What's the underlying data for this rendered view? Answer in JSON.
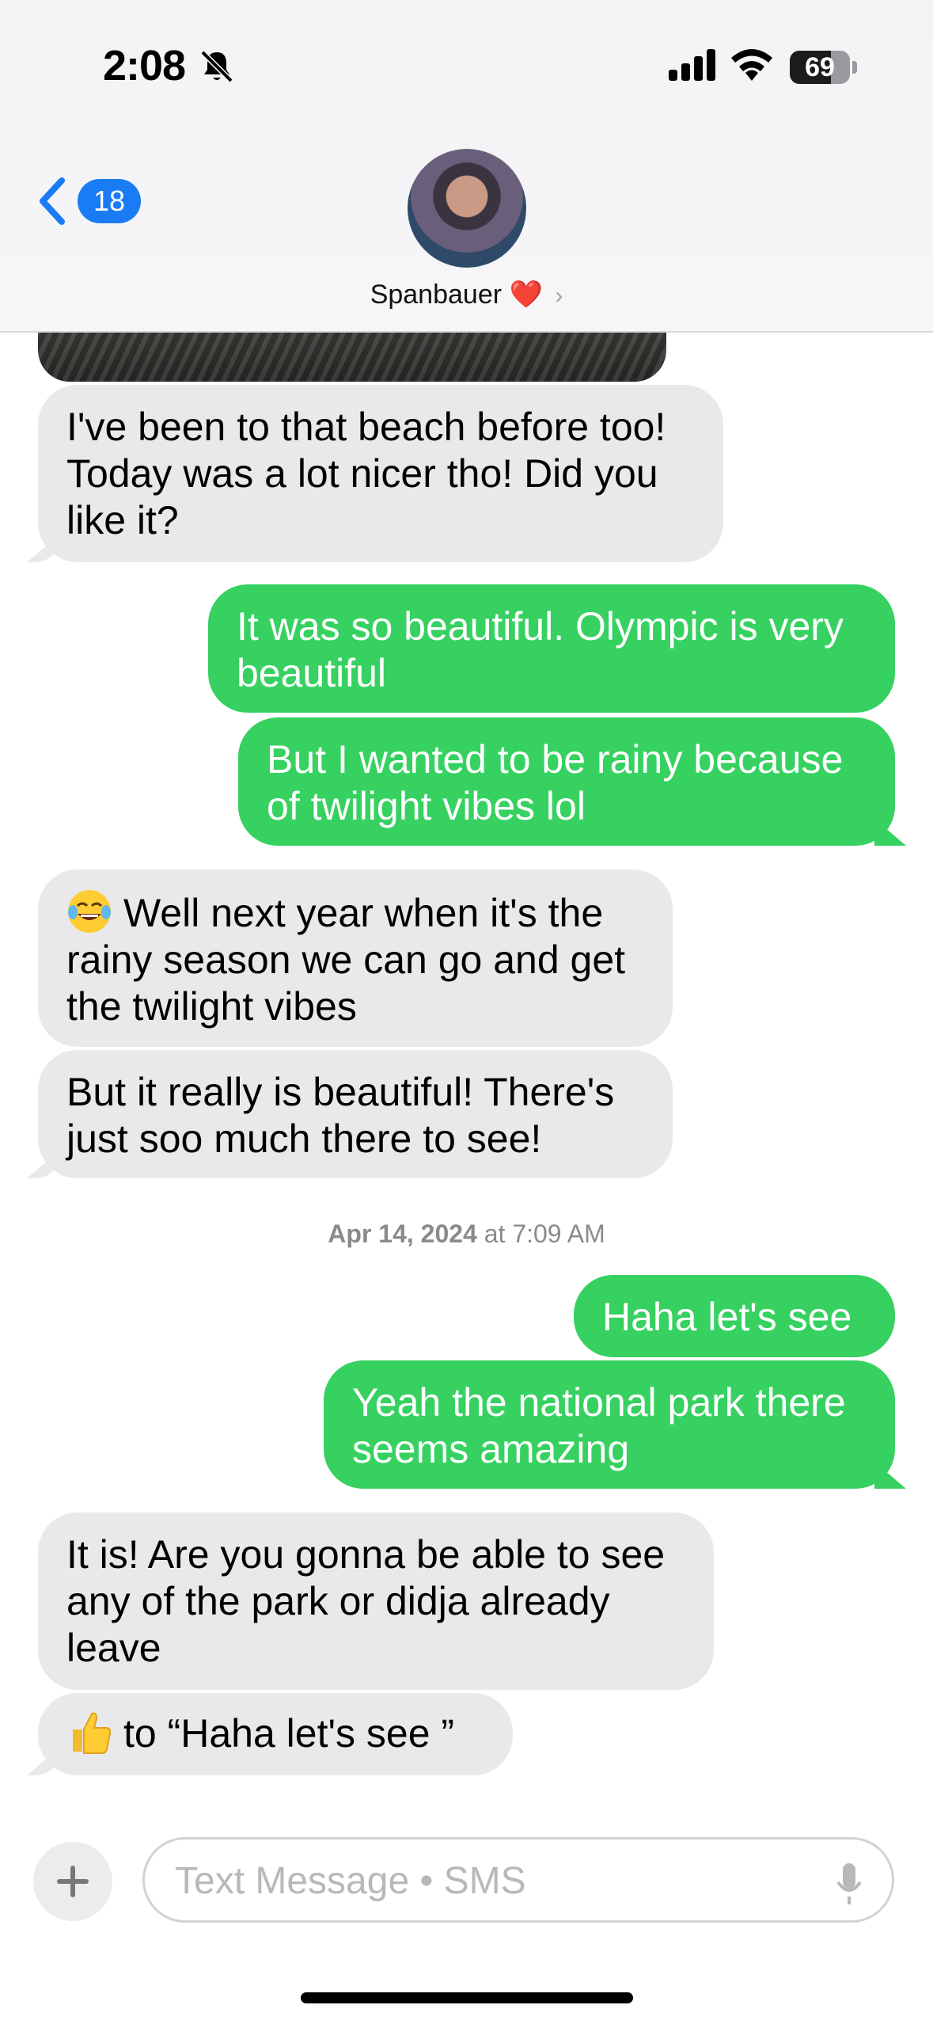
{
  "status_bar": {
    "time": "2:08",
    "battery": "69",
    "battery_level": 0.69
  },
  "header": {
    "back_count": "18",
    "contact_name": "Spanbauer",
    "contact_heart": "❤️"
  },
  "messages": [
    {
      "from": "them",
      "text": "I've been to that beach before too! Today was a lot nicer tho! Did you like it?"
    },
    {
      "from": "me",
      "text": "It was so beautiful. Olympic is very beautiful"
    },
    {
      "from": "me",
      "text": "But I wanted to be rainy because of twilight vibes lol"
    },
    {
      "from": "them",
      "text": "Well next year when it's the rainy season we can go and get the twilight vibes",
      "emoji": "tears-of-joy-emoji"
    },
    {
      "from": "them",
      "text": "But it really is beautiful! There's just soo much there to see!"
    },
    {
      "from": "me",
      "text": "Haha let's see"
    },
    {
      "from": "me",
      "text": "Yeah the national park there seems amazing"
    },
    {
      "from": "them",
      "text": "It is! Are you gonna be able to see any of the park or didja already leave"
    },
    {
      "from": "them",
      "text": "to “Haha let's see ”",
      "emoji": "thumbs-up-emoji"
    }
  ],
  "timestamp": {
    "date": "Apr 14, 2024",
    "at": "at",
    "time": "7:09 AM"
  },
  "composer": {
    "placeholder": "Text Message • SMS"
  },
  "colors": {
    "sent_bubble": "#36d160",
    "received_bubble": "#e9e9eb",
    "accent": "#1a7cf5"
  }
}
